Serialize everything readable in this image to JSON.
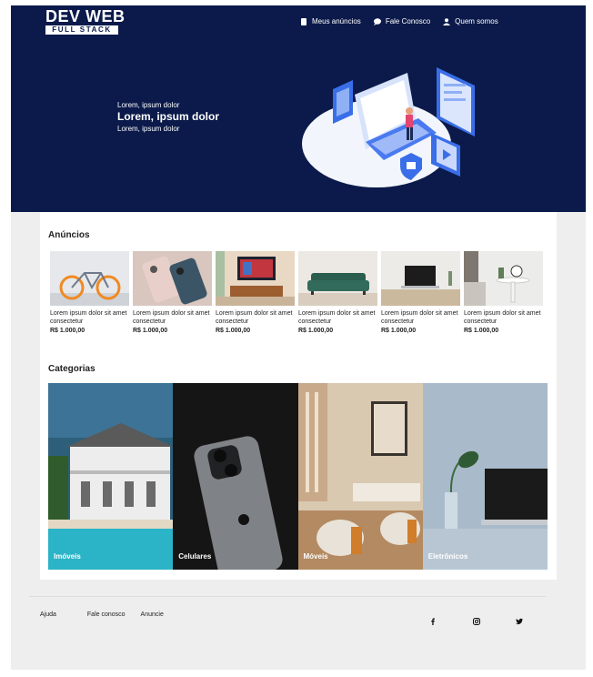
{
  "brand": {
    "line1": "DEV WEB",
    "line2": "FULL STACK"
  },
  "nav": [
    {
      "label": "Meus anúncios",
      "icon": "file-icon"
    },
    {
      "label": "Fale Conosco",
      "icon": "chat-icon"
    },
    {
      "label": "Quem somos",
      "icon": "user-icon"
    }
  ],
  "hero": {
    "line1": "Lorem, ipsum dolor",
    "line2": "Lorem, ipsum dolor",
    "line3": "Lorem, ipsum dolor"
  },
  "ads_section": {
    "title": "Anúncios",
    "items": [
      {
        "desc": "Lorem ipsum dolor sit amet consectetur",
        "price": "R$ 1.000,00",
        "image": "bicycle"
      },
      {
        "desc": "Lorem ipsum dolor sit amet consectetur",
        "price": "R$ 1.000,00",
        "image": "smartphone"
      },
      {
        "desc": "Lorem ipsum dolor sit amet consectetur",
        "price": "R$ 1.000,00",
        "image": "tv-stand"
      },
      {
        "desc": "Lorem ipsum dolor sit amet consectetur",
        "price": "R$ 1.000,00",
        "image": "sofa"
      },
      {
        "desc": "Lorem ipsum dolor sit amet consectetur",
        "price": "R$ 1.000,00",
        "image": "laptop"
      },
      {
        "desc": "Lorem ipsum dolor sit amet consectetur",
        "price": "R$ 1.000,00",
        "image": "bedroom-table"
      }
    ]
  },
  "categories_section": {
    "title": "Categorias",
    "items": [
      {
        "label": "Imóveis",
        "image": "house-with-pool"
      },
      {
        "label": "Celulares",
        "image": "iphone"
      },
      {
        "label": "Móveis",
        "image": "living-room"
      },
      {
        "label": "Eletrônicos",
        "image": "laptop-and-plant"
      }
    ]
  },
  "footer": {
    "links": [
      "Ajuda",
      "Fale conosco",
      "Anuncie"
    ],
    "social": [
      "facebook-icon",
      "instagram-icon",
      "twitter-icon"
    ]
  },
  "colors": {
    "hero_bg": "#0b1a4a",
    "accent": "#3a6ee8"
  }
}
